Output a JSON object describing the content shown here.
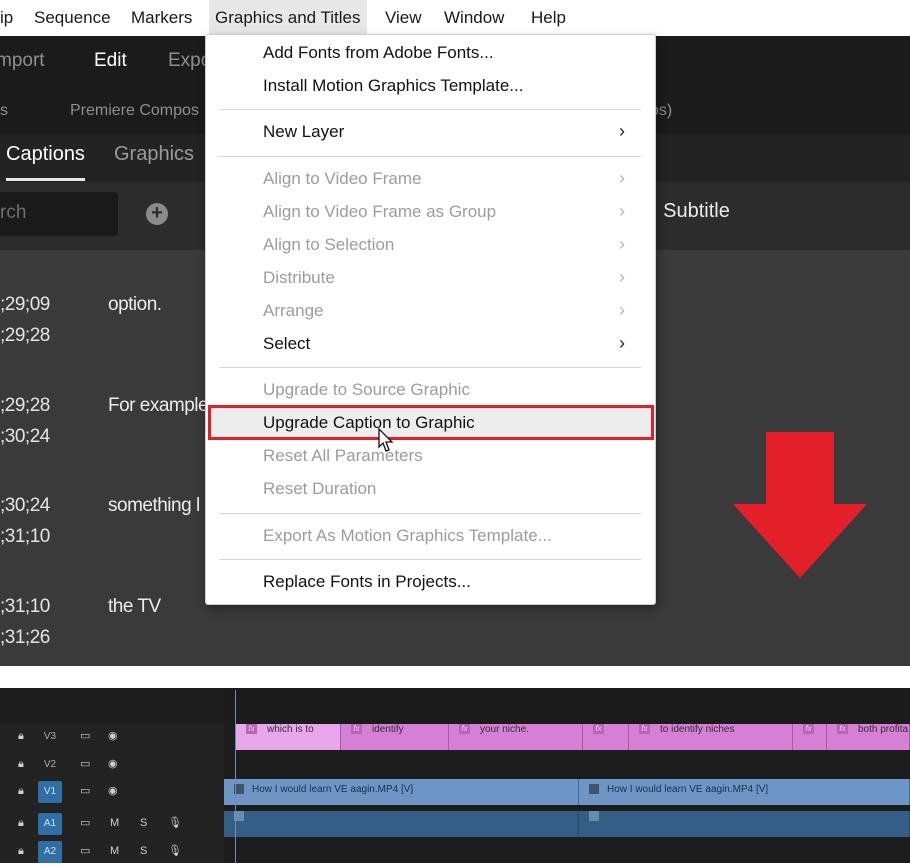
{
  "menubar": {
    "items": [
      "ip",
      "Sequence",
      "Markers",
      "Graphics and Titles",
      "View",
      "Window",
      "Help"
    ]
  },
  "workspace_tabs": [
    "mport",
    "Edit",
    "Expo"
  ],
  "breadcrumbs": [
    "s",
    "Premiere Compos",
    "os)"
  ],
  "panel_tabs": [
    "Captions",
    "Graphics"
  ],
  "search": {
    "placeholder": "rch"
  },
  "track_label": ": Subtitle",
  "captions": [
    {
      "tc_in": ";29;09",
      "tc_out": ";29;28",
      "text": "option."
    },
    {
      "tc_in": ";29;28",
      "tc_out": ";30;24",
      "text": "For example"
    },
    {
      "tc_in": ";30;24",
      "tc_out": ";31;10",
      "text": "something l"
    },
    {
      "tc_in": ";31;10",
      "tc_out": ";31;26",
      "text": "the TV"
    }
  ],
  "dropdown": {
    "items": [
      {
        "label": "Add Fonts from Adobe Fonts...",
        "enabled": true,
        "submenu": false
      },
      {
        "label": "Install Motion Graphics Template...",
        "enabled": true,
        "submenu": false
      },
      {
        "label": "New Layer",
        "enabled": true,
        "submenu": true
      },
      {
        "label": "Align to Video Frame",
        "enabled": false,
        "submenu": true
      },
      {
        "label": "Align to Video Frame as Group",
        "enabled": false,
        "submenu": true
      },
      {
        "label": "Align to Selection",
        "enabled": false,
        "submenu": true
      },
      {
        "label": "Distribute",
        "enabled": false,
        "submenu": true
      },
      {
        "label": "Arrange",
        "enabled": false,
        "submenu": true
      },
      {
        "label": "Select",
        "enabled": true,
        "submenu": true
      },
      {
        "label": "Upgrade to Source Graphic",
        "enabled": false,
        "submenu": false
      },
      {
        "label": "Upgrade Caption to Graphic",
        "enabled": true,
        "submenu": false,
        "highlighted": true
      },
      {
        "label": "Reset All Parameters",
        "enabled": false,
        "submenu": false
      },
      {
        "label": "Reset Duration",
        "enabled": false,
        "submenu": false
      },
      {
        "label": "Export As Motion Graphics Template...",
        "enabled": false,
        "submenu": false
      },
      {
        "label": "Replace Fonts in Projects...",
        "enabled": true,
        "submenu": false
      }
    ]
  },
  "timeline": {
    "tracks": [
      {
        "label": "V3",
        "selected": false
      },
      {
        "label": "V2",
        "selected": false
      },
      {
        "label": "V1",
        "selected": true
      },
      {
        "label": "A1",
        "selected": true
      },
      {
        "label": "A2",
        "selected": true
      }
    ],
    "track_buttons": {
      "mute": "M",
      "solo": "S"
    },
    "graphic_clips": [
      "which is to",
      "identify",
      "your niche.",
      "",
      "to identify niches",
      "",
      "both profita"
    ],
    "video_clips": [
      "How I would learn VE aagin.MP4 [V]",
      "How I would learn VE aagin.MP4 [V]"
    ]
  },
  "colors": {
    "highlight_box": "#e3202a",
    "arrow": "#e3202a",
    "graphic_clip": "#d57fd6",
    "video_clip": "#6d96c7",
    "audio_clip": "#345e86"
  }
}
